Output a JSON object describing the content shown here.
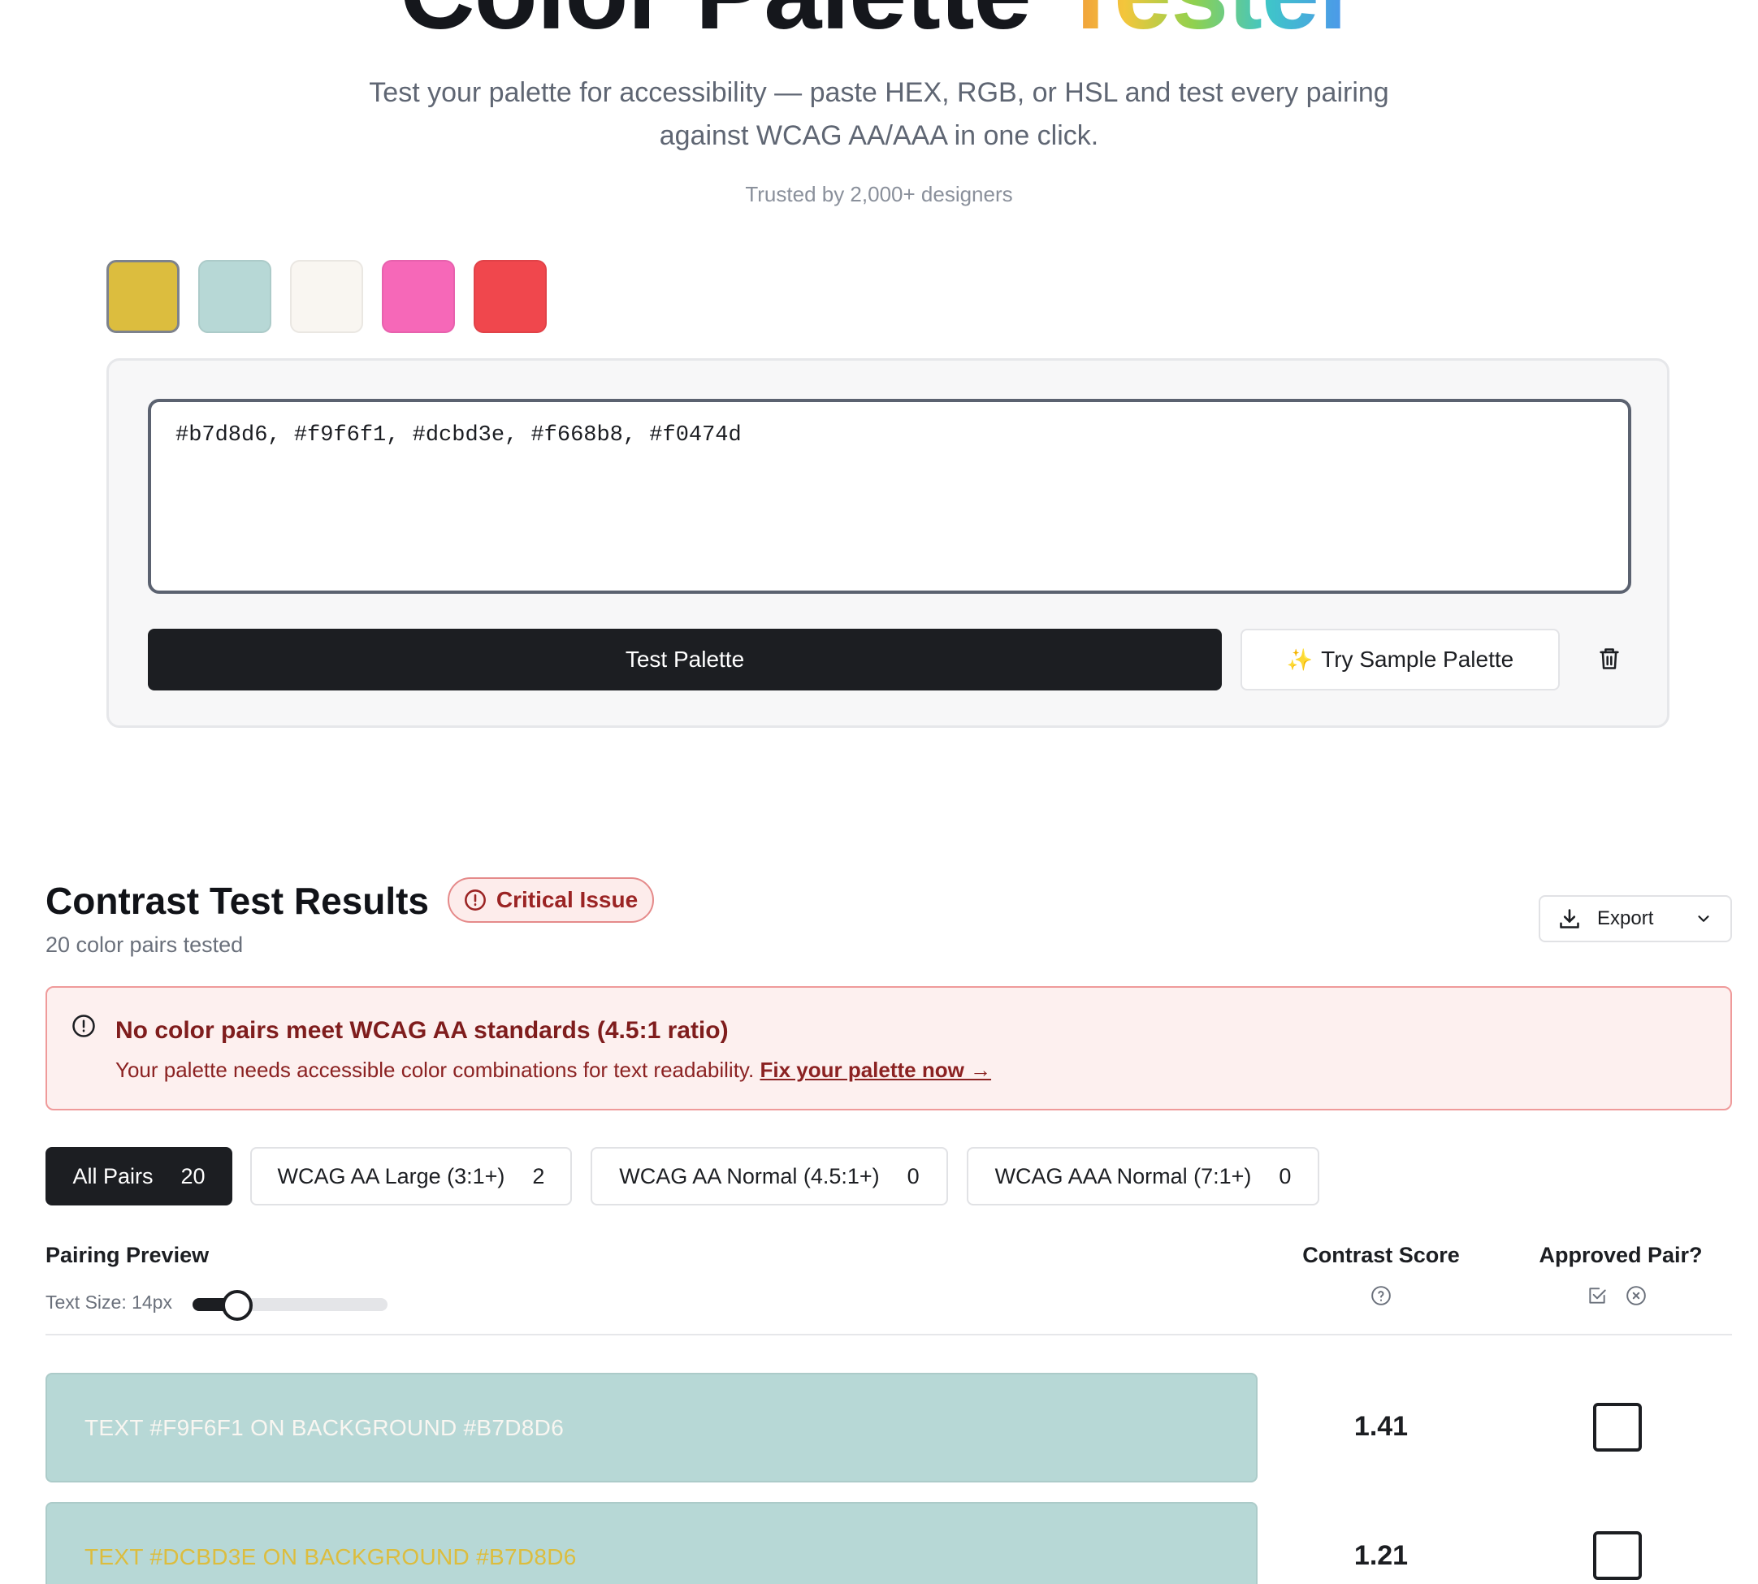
{
  "hero": {
    "title_main": "Color Palette",
    "title_accent": "Tester",
    "subtitle": "Test your palette for accessibility — paste HEX, RGB, or HSL and test every pairing against WCAG AA/AAA in one click.",
    "trust": "Trusted by 2,000+ designers"
  },
  "swatches": [
    {
      "color": "#dcbd3e",
      "selected": true
    },
    {
      "color": "#b7d8d6",
      "selected": false
    },
    {
      "color": "#f9f6f1",
      "selected": false
    },
    {
      "color": "#f668b8",
      "selected": false
    },
    {
      "color": "#f0474d",
      "selected": false
    }
  ],
  "input": {
    "value": "#b7d8d6, #f9f6f1, #dcbd3e, #f668b8, #f0474d"
  },
  "buttons": {
    "test": "Test Palette",
    "sample": "Try Sample Palette",
    "trash_icon": "trash-icon"
  },
  "results": {
    "title": "Contrast Test Results",
    "badge": "Critical Issue",
    "pairs_tested": "20 color pairs tested",
    "export": "Export"
  },
  "alert": {
    "title": "No color pairs meet WCAG AA standards (4.5:1 ratio)",
    "body": "Your palette needs accessible color combinations for text readability.",
    "link": "Fix your palette now →"
  },
  "tabs": [
    {
      "label": "All Pairs",
      "count": "20",
      "active": true
    },
    {
      "label": "WCAG AA Large (3:1+)",
      "count": "2",
      "active": false
    },
    {
      "label": "WCAG AA Normal (4.5:1+)",
      "count": "0",
      "active": false
    },
    {
      "label": "WCAG AAA Normal (7:1+)",
      "count": "0",
      "active": false
    }
  ],
  "table": {
    "col_preview": "Pairing Preview",
    "col_score": "Contrast Score",
    "col_approved": "Approved Pair?",
    "text_size_label": "Text Size: 14px",
    "text_size_fraction": 0.23
  },
  "rows": [
    {
      "text": "Text #F9F6F1 on background #B7D8D6",
      "fg": "#f9f6f1",
      "bg": "#b7d8d6",
      "score": "1.41",
      "approved": false
    },
    {
      "text": "Text #DCBD3E on background #B7D8D6",
      "fg": "#dcbd3e",
      "bg": "#b7d8d6",
      "score": "1.21",
      "approved": false
    }
  ]
}
